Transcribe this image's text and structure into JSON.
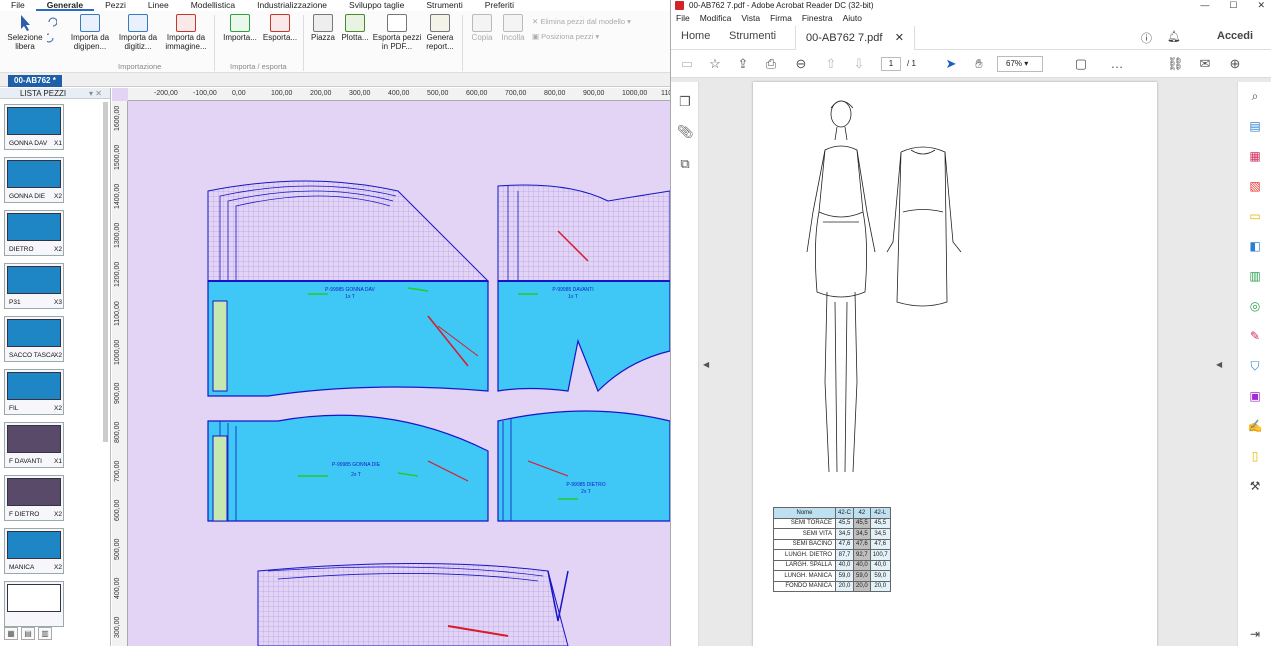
{
  "cad": {
    "menu": [
      "File",
      "Generale",
      "Pezzi",
      "Linee",
      "Modellistica",
      "Industrializzazione",
      "Sviluppo taglie",
      "Strumenti",
      "Preferiti"
    ],
    "menu_active": "Generale",
    "ribbon": {
      "selezione": "Selezione libera",
      "importa_digipen": "Importa da digipen...",
      "importa_digitizer": "Importa da digitiz...",
      "importa_immagine": "Importa da immagine...",
      "importa": "Importa...",
      "esporta": "Esporta...",
      "piazza": "Piazza",
      "plotta": "Plotta...",
      "esporta_pdf": "Esporta pezzi in PDF...",
      "genera_report": "Genera report...",
      "copia": "Copia",
      "incolla": "Incolla",
      "elimina": "Elimina pezzi dal modello",
      "posiziona": "Posiziona pezzi",
      "grp_importazione": "Importazione",
      "grp_import_export": "Importa / esporta"
    },
    "doc_tab": "00-AB762 *",
    "lista_title": "LISTA PEZZI",
    "pieces": [
      {
        "label": "GONNA DAV",
        "qty": "X1"
      },
      {
        "label": "GONNA DIE",
        "qty": "X2"
      },
      {
        "label": "DIETRO",
        "qty": "X2"
      },
      {
        "label": "P31",
        "qty": "X3"
      },
      {
        "label": "SACCO TASCA",
        "qty": "X2"
      },
      {
        "label": "FIL",
        "qty": "X2"
      },
      {
        "label": "F DAVANTI",
        "qty": "X1"
      },
      {
        "label": "F DIETRO",
        "qty": "X2"
      },
      {
        "label": "MANICA",
        "qty": "X2"
      },
      {
        "label": "",
        "qty": ""
      }
    ],
    "ruler_h": [
      "-200,00",
      "-100,00",
      "0,00",
      "100,00",
      "200,00",
      "300,00",
      "400,00",
      "500,00",
      "600,00",
      "700,00",
      "800,00",
      "900,00",
      "1000,00",
      "110"
    ],
    "ruler_v": [
      "1600,00",
      "1500,00",
      "1400,00",
      "1300,00",
      "1200,00",
      "1100,00",
      "1000,00",
      "900,00",
      "800,00",
      "700,00",
      "600,00",
      "500,00",
      "400,00",
      "300,00"
    ],
    "canvas_labels": {
      "gonna_dav": "P-99985 GONNA DAV",
      "gonna_dav_qty": "1x T",
      "davanti": "P-99985 DAVANTI",
      "davanti_qty": "1x T",
      "gonna_die": "P-99985 GONNA DIE",
      "gonna_die_qty": "2x T",
      "dietro": "P-99985 DIETRO",
      "dietro_qty": "2x T"
    },
    "colors": {
      "canvas": "#e3d3f5",
      "fill": "#3fc8f5",
      "line": "#1616c8",
      "accent": "#d81b2a",
      "green": "#22cc22"
    }
  },
  "acrobat": {
    "title": "00-AB762 7.pdf - Adobe Acrobat Reader DC (32-bit)",
    "menu": [
      "File",
      "Modifica",
      "Vista",
      "Firma",
      "Finestra",
      "Aiuto"
    ],
    "tabs": {
      "home": "Home",
      "strumenti": "Strumenti",
      "doc": "00-AB762 7.pdf"
    },
    "accedi": "Accedi",
    "page_current": "1",
    "page_total": "/ 1",
    "zoom": "67%",
    "table": {
      "headers": [
        "Nome",
        "42-C",
        "42",
        "42-L"
      ],
      "rows": [
        [
          "SEMI TORACE",
          "45,5",
          "45,5",
          "45,5"
        ],
        [
          "SEMI VITA",
          "34,5",
          "34,5",
          "34,5"
        ],
        [
          "SEMI BACINO",
          "47,6",
          "47,6",
          "47,6"
        ],
        [
          "LUNGH. DIETRO",
          "87,7",
          "92,7",
          "100,7"
        ],
        [
          "LARGH. SPALLA",
          "40,0",
          "40,0",
          "40,0"
        ],
        [
          "LUNGH. MANICA",
          "59,0",
          "59,0",
          "59,0"
        ],
        [
          "FONDO MANICA",
          "20,0",
          "20,0",
          "20,0"
        ]
      ]
    }
  }
}
